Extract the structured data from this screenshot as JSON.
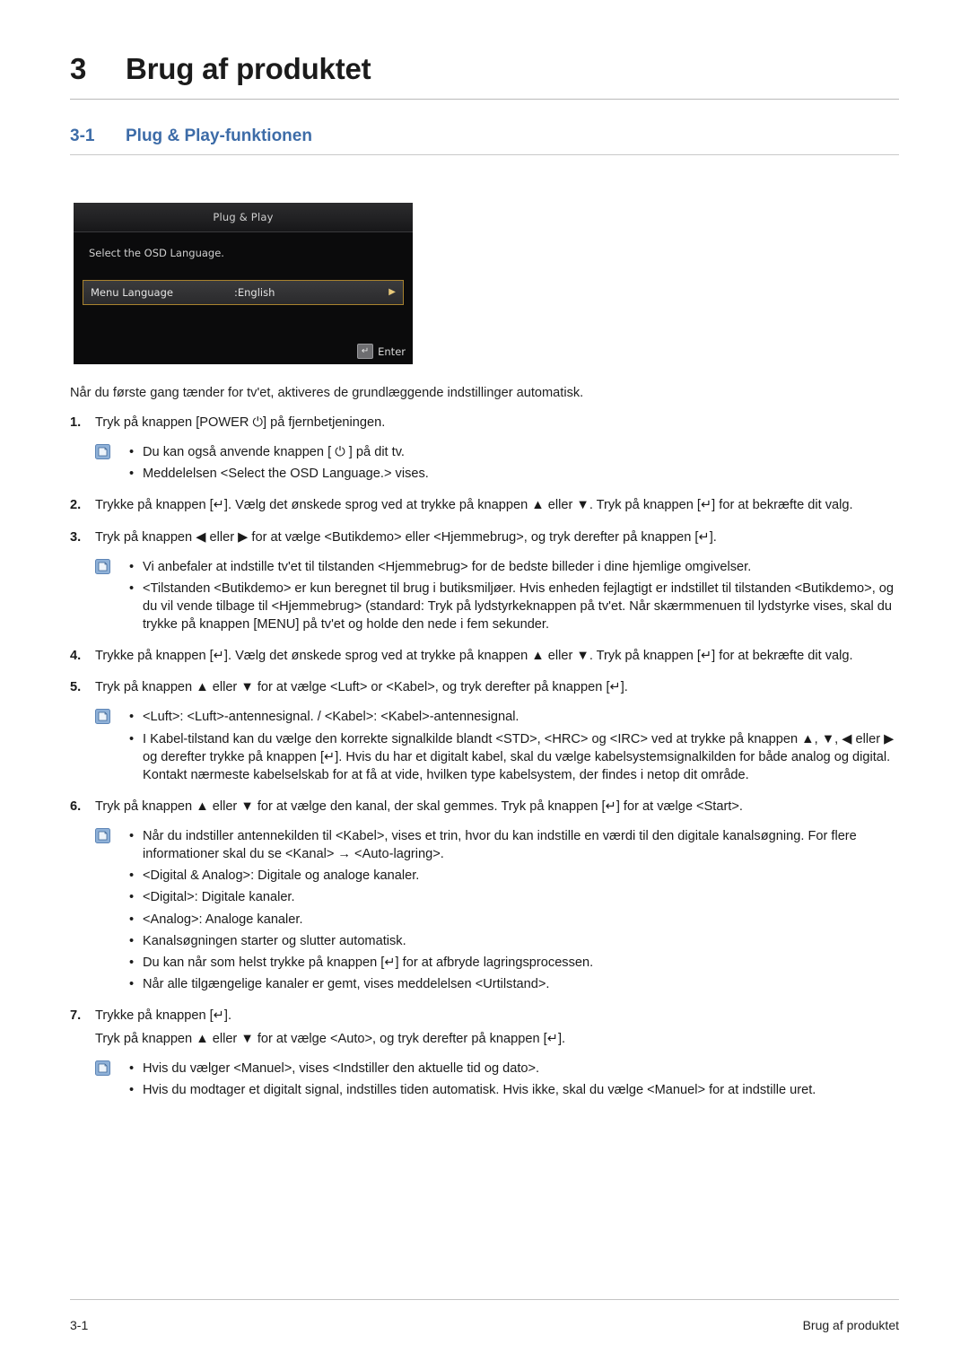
{
  "chapter": {
    "number": "3",
    "title": "Brug af produktet"
  },
  "section": {
    "number": "3-1",
    "title": "Plug & Play-funktionen"
  },
  "osd": {
    "title": "Plug & Play",
    "subtitle": "Select the OSD Language.",
    "row_label": "Menu Language",
    "row_value": ":English",
    "row_arrow": "▶",
    "enter_key_glyph": "↵",
    "enter_label": "Enter"
  },
  "intro": "Når du første gang tænder for tv'et, aktiveres de grundlæggende indstillinger automatisk.",
  "steps": [
    {
      "num": "1.",
      "text": "Tryk på knappen [POWER ⏻] på fjernbetjeningen."
    },
    {
      "num": "2.",
      "text": "Trykke på knappen [↵]. Vælg det ønskede sprog ved at trykke på knappen ▲ eller ▼. Tryk på knappen [↵] for at bekræfte dit valg."
    },
    {
      "num": "3.",
      "text": "Tryk på knappen ◀ eller ▶ for at vælge <Butikdemo> eller <Hjemmebrug>, og tryk derefter på knappen [↵]."
    },
    {
      "num": "4.",
      "text": "Trykke på knappen [↵]. Vælg det ønskede sprog ved at trykke på knappen ▲ eller ▼. Tryk på knappen [↵] for at bekræfte dit valg."
    },
    {
      "num": "5.",
      "text": "Tryk på knappen ▲ eller ▼ for at vælge <Luft> or <Kabel>, og tryk derefter på knappen [↵]."
    },
    {
      "num": "6.",
      "text": "Tryk på knappen ▲ eller ▼ for at vælge den kanal, der skal gemmes. Tryk på knappen [↵] for at vælge <Start>."
    },
    {
      "num": "7.",
      "text": "Trykke på knappen [↵]."
    }
  ],
  "step7_extra": "Tryk på knappen ▲ eller ▼ for at vælge <Auto>, og tryk derefter på knappen [↵].",
  "note_groups": [
    {
      "icon": "note-icon",
      "items": [
        "Du kan også anvende knappen [ ⏻ ] på dit tv.",
        "Meddelelsen <Select the OSD Language.> vises."
      ]
    },
    {
      "icon": "note-icon",
      "items": [
        "Vi anbefaler at indstille tv'et til tilstanden <Hjemmebrug> for de bedste billeder i dine hjemlige omgivelser.",
        "<Tilstanden <Butikdemo> er kun beregnet til brug i butiksmiljøer. Hvis enheden fejlagtigt er indstillet til tilstanden <Butikdemo>, og du vil vende tilbage til <Hjemmebrug> (standard: Tryk på lydstyrkeknappen på tv'et. Når skærmmenuen til lydstyrke vises, skal du trykke på knappen [MENU] på tv'et og holde den nede i fem sekunder."
      ]
    },
    {
      "icon": "note-icon",
      "items": [
        "<Luft>: <Luft>-antennesignal. / <Kabel>: <Kabel>-antennesignal.",
        "I Kabel-tilstand kan du vælge den korrekte signalkilde blandt <STD>, <HRC> og <IRC> ved at trykke på knappen ▲, ▼, ◀ eller ▶ og derefter trykke på knappen [↵]. Hvis du har et digitalt kabel, skal du vælge kabelsystemsignalkilden for både analog og digital. Kontakt nærmeste kabelselskab for at få at vide, hvilken type kabelsystem, der findes i netop dit område."
      ]
    },
    {
      "icon": "note-icon",
      "items": [
        "Når du indstiller antennekilden til <Kabel>, vises et trin, hvor du kan indstille en værdi til den digitale kanalsøgning. For flere informationer skal du se <Kanal> → <Auto-lagring>.",
        "<Digital & Analog>: Digitale og analoge kanaler.",
        "<Digital>: Digitale kanaler.",
        "<Analog>: Analoge kanaler.",
        "Kanalsøgningen starter og slutter automatisk.",
        "Du kan når som helst trykke på knappen [↵] for at afbryde lagringsprocessen.",
        "Når alle tilgængelige kanaler er gemt, vises meddelelsen <Urtilstand>."
      ]
    },
    {
      "icon": "note-icon",
      "items": [
        "Hvis du vælger <Manuel>, vises <Indstiller den aktuelle tid og dato>.",
        "Hvis du modtager et digitalt signal, indstilles tiden automatisk. Hvis ikke, skal du vælge <Manuel> for at indstille uret."
      ]
    }
  ],
  "footer": {
    "left": "3-1",
    "right": "Brug af produktet"
  },
  "colors": {
    "section_accent": "#3d6ca8",
    "osd_highlight_border": "#a8822e",
    "note_icon": "#8fb1d8"
  }
}
